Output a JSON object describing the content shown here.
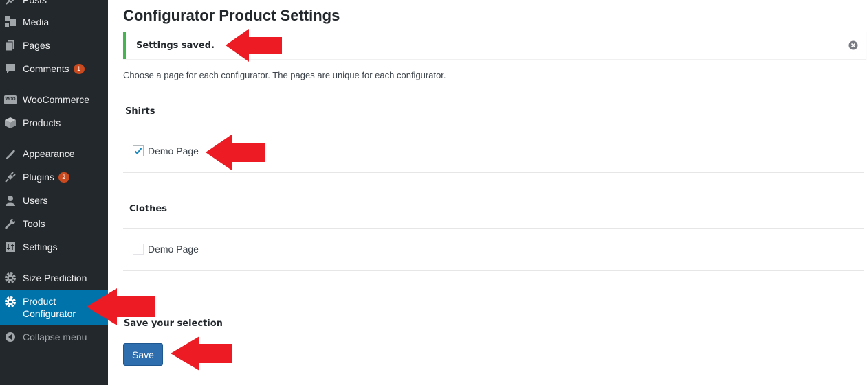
{
  "sidebar": {
    "items": [
      {
        "label": "Posts",
        "icon": "pin-icon"
      },
      {
        "label": "Media",
        "icon": "media-icon"
      },
      {
        "label": "Pages",
        "icon": "pages-icon"
      },
      {
        "label": "Comments",
        "icon": "comment-icon",
        "badge": "1"
      },
      {
        "label": "WooCommerce",
        "icon": "woocommerce-icon",
        "icon_text": "WOO"
      },
      {
        "label": "Products",
        "icon": "box-icon"
      },
      {
        "label": "Appearance",
        "icon": "brush-icon"
      },
      {
        "label": "Plugins",
        "icon": "plugin-icon",
        "badge": "2"
      },
      {
        "label": "Users",
        "icon": "user-icon"
      },
      {
        "label": "Tools",
        "icon": "wrench-icon"
      },
      {
        "label": "Settings",
        "icon": "sliders-icon"
      },
      {
        "label": "Size Prediction",
        "icon": "gear-icon"
      },
      {
        "label_line1": "Product",
        "label_line2": "Configurator",
        "icon": "gear-icon",
        "active": true
      },
      {
        "label": "Collapse menu",
        "icon": "collapse-icon"
      }
    ]
  },
  "page": {
    "title": "Configurator Product Settings",
    "notice": "Settings saved.",
    "intro": "Choose a page for each configurator. The pages are unique for each configurator.",
    "sections": [
      {
        "heading": "Shirts",
        "option_label": "Demo Page",
        "checked": true
      },
      {
        "heading": "Clothes",
        "option_label": "Demo Page",
        "checked": false
      }
    ],
    "save_heading": "Save your selection",
    "save_label": "Save"
  },
  "colors": {
    "sidebar_bg": "#23282d",
    "active_bg": "#0073aa",
    "notice_border": "#46b450",
    "button_bg": "#2e6eaf",
    "badge_bg": "#ca4a1f",
    "annotation_arrow": "#ed1c24"
  }
}
